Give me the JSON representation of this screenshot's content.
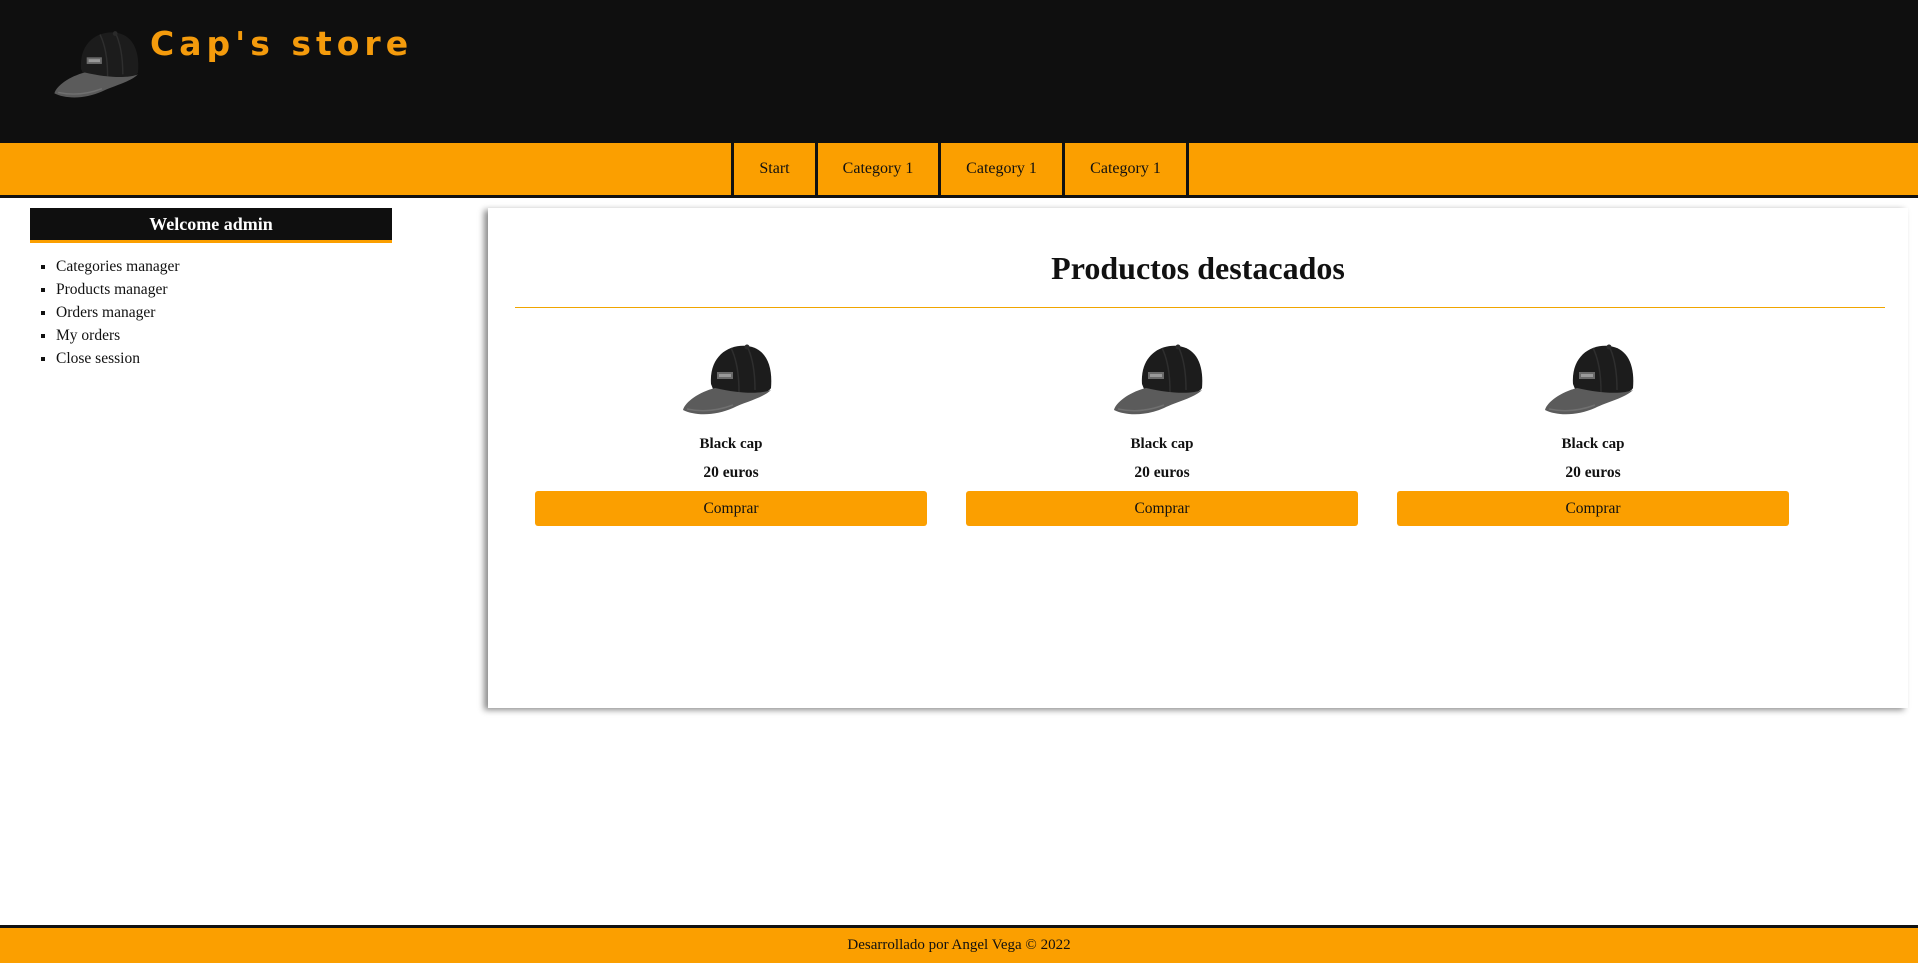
{
  "header": {
    "title": "Cap's store",
    "logo_icon": "cap-icon"
  },
  "nav": {
    "items": [
      {
        "label": "Start"
      },
      {
        "label": "Category 1"
      },
      {
        "label": "Category 1"
      },
      {
        "label": "Category 1"
      }
    ]
  },
  "sidebar": {
    "welcome": "Welcome admin",
    "items": [
      {
        "label": "Categories manager"
      },
      {
        "label": "Products manager"
      },
      {
        "label": "Orders manager"
      },
      {
        "label": "My orders"
      },
      {
        "label": "Close session"
      }
    ]
  },
  "main": {
    "title": "Productos destacados",
    "products": [
      {
        "name": "Black cap",
        "price": "20 euros",
        "button": "Comprar"
      },
      {
        "name": "Black cap",
        "price": "20 euros",
        "button": "Comprar"
      },
      {
        "name": "Black cap",
        "price": "20 euros",
        "button": "Comprar"
      }
    ]
  },
  "footer": {
    "text": "Desarrollado por Angel Vega © 2022"
  },
  "colors": {
    "accent": "#fb9f00",
    "header_bg": "#0f0f0f",
    "title_color": "#f49b0c"
  }
}
